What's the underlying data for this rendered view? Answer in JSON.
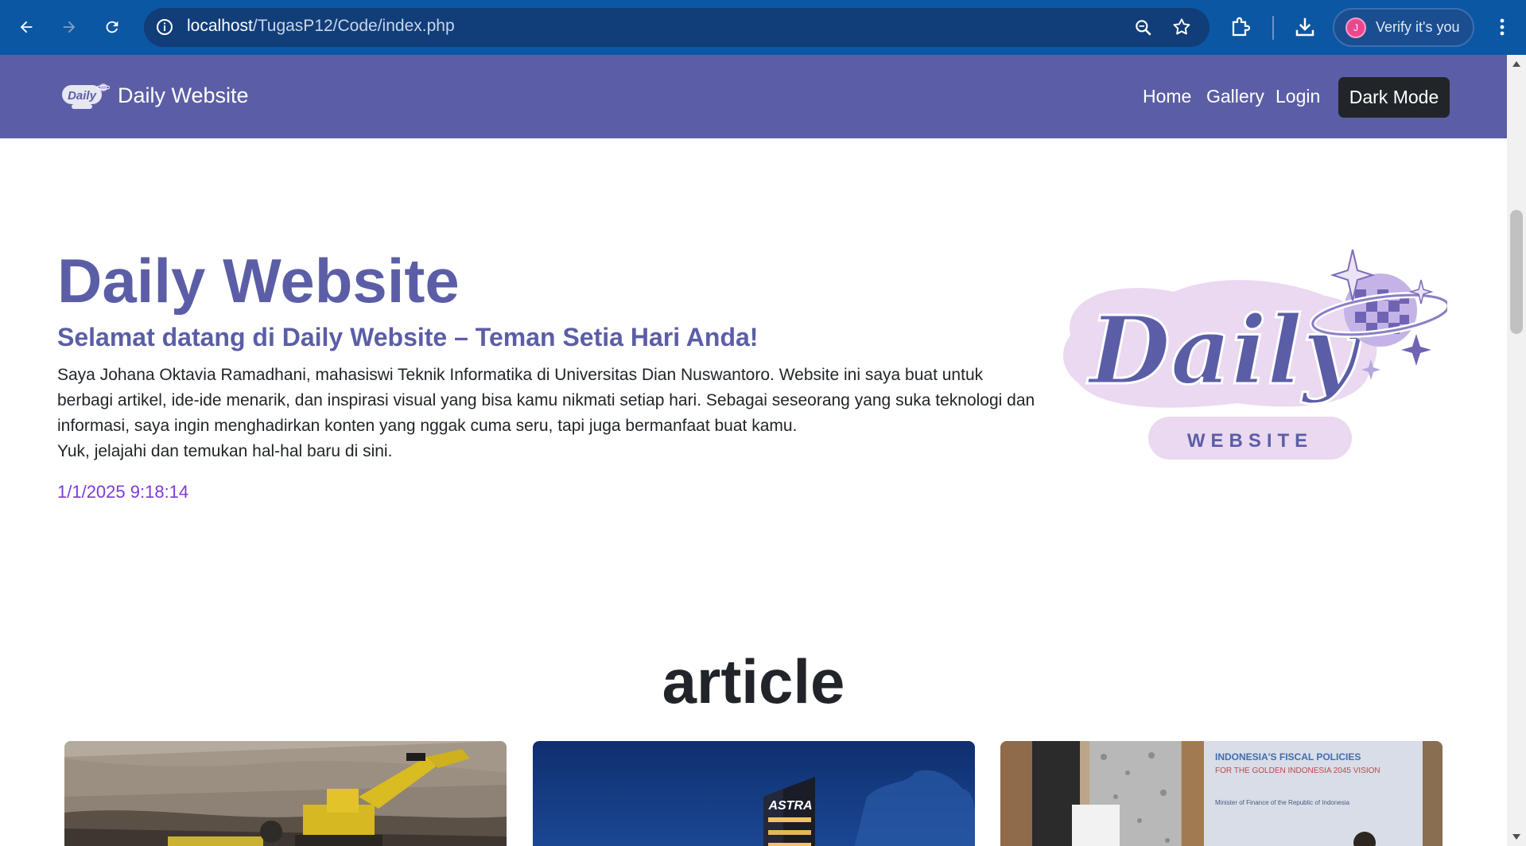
{
  "browser": {
    "url_host": "localhost",
    "url_path": "/TugasP12/Code/index.php",
    "verify_label": "Verify it's you",
    "avatar_letter": "J",
    "icons": [
      "back-arrow-icon",
      "forward-arrow-icon",
      "reload-icon",
      "site-info-icon",
      "zoom-icon",
      "bookmark-star-icon",
      "extensions-icon",
      "download-icon",
      "menu-kebab-icon"
    ]
  },
  "navbar": {
    "brand": "Daily Website",
    "links": [
      "Home",
      "Gallery",
      "Login"
    ],
    "dark_mode_label": "Dark Mode",
    "background": "#5b5ea6"
  },
  "hero": {
    "title": "Daily Website",
    "subtitle": "Selamat datang di Daily Website – Teman Setia Hari Anda!",
    "paragraph_line1": "Saya Johana Oktavia Ramadhani, mahasiswi Teknik Informatika di Universitas Dian Nuswantoro. Website ini saya buat untuk berbagi artikel, ide-ide menarik, dan inspirasi visual yang bisa kamu nikmati setiap hari. Sebagai seseorang yang suka teknologi dan informasi, saya ingin menghadirkan konten yang nggak cuma seru, tapi juga bermanfaat buat kamu.",
    "paragraph_line2": "Yuk, jelajahi dan temukan hal-hal baru di sini.",
    "timestamp": "1/1/2025 9:18:14",
    "logo_word": "Daily",
    "logo_tag": "WEBSITE"
  },
  "articles": {
    "heading": "article",
    "cards": [
      {
        "image": "excavator-mining-photo"
      },
      {
        "image": "astra-building-night-photo",
        "sign_text": "ASTRA"
      },
      {
        "image": "fiscal-policy-presentation-photo",
        "slide_title": "INDONESIA'S FISCAL POLICIES",
        "slide_subtitle": "FOR THE GOLDEN INDONESIA 2045 VISION",
        "slide_line": "Minister of Finance of the Republic of Indonesia"
      }
    ]
  },
  "colors": {
    "accent": "#5b5ea6",
    "timestamp": "#7d3bd8",
    "chrome": "#0b57a4"
  }
}
